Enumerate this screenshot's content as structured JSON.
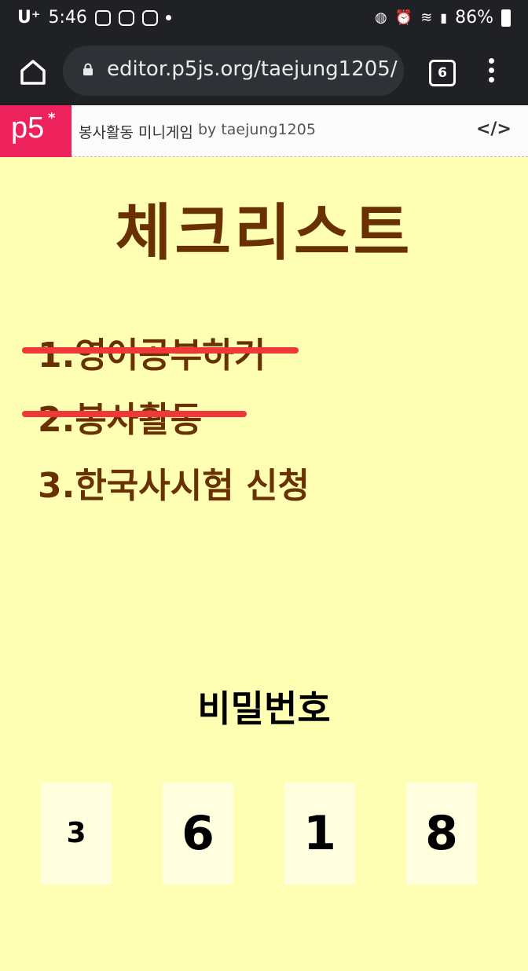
{
  "status_bar": {
    "carrier": "U⁺",
    "time": "5:46",
    "battery": "86%"
  },
  "browser": {
    "url": "editor.p5js.org/taejung1205/",
    "tab_count": "6"
  },
  "p5_header": {
    "logo": "p5",
    "sketch_title": "봉사활동 미니게임",
    "author": "by  taejung1205"
  },
  "checklist": {
    "title": "체크리스트",
    "items": [
      {
        "label": "1.영어공부하기",
        "done": true
      },
      {
        "label": "2.봉사활동",
        "done": true
      },
      {
        "label": "3.한국사시험 신청",
        "done": false
      }
    ]
  },
  "password": {
    "title": "비밀번호",
    "digits": [
      "3",
      "6",
      "1",
      "8"
    ]
  },
  "colors": {
    "background": "#ffffb4",
    "text_brown": "#6a3100",
    "strike_red": "#f0373a",
    "p5_pink": "#ed225d",
    "chrome_dark": "#1f2125"
  }
}
